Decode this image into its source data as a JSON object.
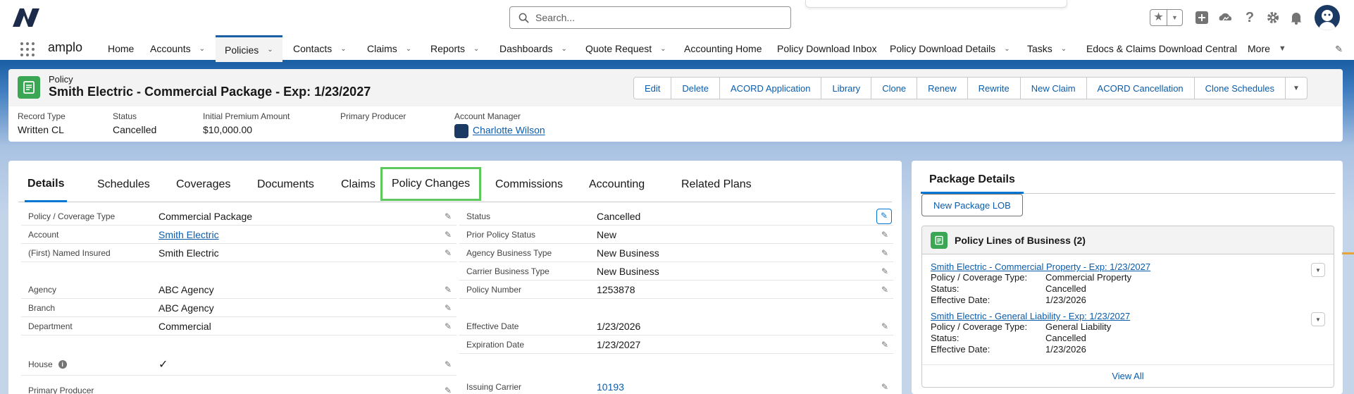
{
  "app": {
    "name": "amplo"
  },
  "search": {
    "placeholder": "Search..."
  },
  "utility_icons": [
    "favorites-star-icon",
    "add-icon",
    "trailhead-icon",
    "help-icon",
    "setup-gear-icon",
    "notifications-bell-icon"
  ],
  "nav": {
    "items": [
      {
        "label": "Home",
        "dropdown": false
      },
      {
        "label": "Accounts",
        "dropdown": true
      },
      {
        "label": "Policies",
        "dropdown": true,
        "active": true
      },
      {
        "label": "Contacts",
        "dropdown": true
      },
      {
        "label": "Claims",
        "dropdown": true
      },
      {
        "label": "Reports",
        "dropdown": true
      },
      {
        "label": "Dashboards",
        "dropdown": true
      },
      {
        "label": "Quote Request",
        "dropdown": true
      },
      {
        "label": "Accounting Home",
        "dropdown": false
      },
      {
        "label": "Policy Download Inbox",
        "dropdown": false
      },
      {
        "label": "Policy Download Details",
        "dropdown": true
      },
      {
        "label": "Tasks",
        "dropdown": true
      },
      {
        "label": "Edocs & Claims Download Central",
        "dropdown": false
      },
      {
        "label": "More",
        "dropdown": true
      }
    ]
  },
  "record": {
    "object_label": "Policy",
    "title": "Smith Electric - Commercial Package - Exp: 1/23/2027",
    "actions": [
      "Edit",
      "Delete",
      "ACORD Application",
      "Library",
      "Clone",
      "Renew",
      "Rewrite",
      "New Claim",
      "ACORD Cancellation",
      "Clone Schedules"
    ],
    "highlights": [
      {
        "label": "Record Type",
        "value": "Written CL"
      },
      {
        "label": "Status",
        "value": "Cancelled"
      },
      {
        "label": "Initial Premium Amount",
        "value": "$10,000.00"
      },
      {
        "label": "Primary Producer",
        "value": ""
      },
      {
        "label": "Account Manager",
        "value": "Charlotte Wilson"
      }
    ]
  },
  "tabs": [
    "Details",
    "Schedules",
    "Coverages",
    "Documents",
    "Claims",
    "Policy Changes",
    "Commissions",
    "Accounting",
    "Related Plans"
  ],
  "details": {
    "left": [
      {
        "label": "Policy / Coverage Type",
        "value": "Commercial Package"
      },
      {
        "label": "Account",
        "value": "Smith Electric"
      },
      {
        "label": "(First) Named Insured",
        "value": "Smith Electric"
      },
      {
        "label": "Agency",
        "value": "ABC Agency"
      },
      {
        "label": "Branch",
        "value": "ABC Agency"
      },
      {
        "label": "Department",
        "value": "Commercial"
      },
      {
        "label": "House",
        "value": "✓"
      },
      {
        "label": "Primary Producer",
        "value": ""
      }
    ],
    "right": [
      {
        "label": "Status",
        "value": "Cancelled"
      },
      {
        "label": "Prior Policy Status",
        "value": "New"
      },
      {
        "label": "Agency Business Type",
        "value": "New Business"
      },
      {
        "label": "Carrier Business Type",
        "value": "New Business"
      },
      {
        "label": "Policy Number",
        "value": "1253878"
      },
      {
        "label": "Effective Date",
        "value": "1/23/2026"
      },
      {
        "label": "Expiration Date",
        "value": "1/23/2027"
      },
      {
        "label": "Issuing Carrier",
        "value": "10193"
      }
    ]
  },
  "package": {
    "tab": "Package Details",
    "new_button": "New Package LOB",
    "related_title": "Policy Lines of Business",
    "related_count": "(2)",
    "lines": [
      {
        "name": "Smith Electric - Commercial Property - Exp: 1/23/2027",
        "fields": [
          {
            "k": "Policy / Coverage Type:",
            "v": "Commercial Property"
          },
          {
            "k": "Status:",
            "v": "Cancelled"
          },
          {
            "k": "Effective Date:",
            "v": "1/23/2026"
          }
        ]
      },
      {
        "name": "Smith Electric - General Liability - Exp: 1/23/2027",
        "fields": [
          {
            "k": "Policy / Coverage Type:",
            "v": "General Liability"
          },
          {
            "k": "Status:",
            "v": "Cancelled"
          },
          {
            "k": "Effective Date:",
            "v": "1/23/2026"
          }
        ]
      }
    ],
    "view_all": "View All"
  },
  "colors": {
    "brand": "#1b5fa5",
    "link": "#0b5cab",
    "policy_icon": "#3ba755",
    "highlight_border": "#5dc95d"
  }
}
